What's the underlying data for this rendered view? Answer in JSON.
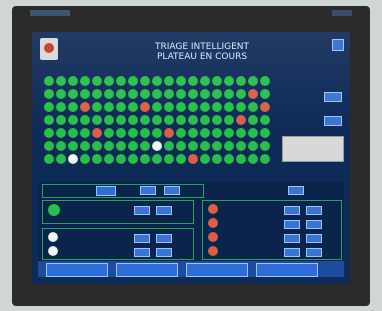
{
  "window": {
    "title_line1": "TRIAGE INTELLIGENT",
    "title_line2": "PLATEAU EN COURS"
  },
  "colors": {
    "screen_bg": "#0e2a57",
    "dot_green": "#27c04c",
    "dot_red": "#e25b4a",
    "dot_white": "#f4f4f4",
    "field_blue": "#3a74d1"
  },
  "grid": {
    "rows": 7,
    "cols": 19,
    "special": [
      {
        "r": 1,
        "c": 17,
        "state": "red"
      },
      {
        "r": 2,
        "c": 3,
        "state": "red"
      },
      {
        "r": 2,
        "c": 8,
        "state": "red"
      },
      {
        "r": 2,
        "c": 18,
        "state": "red"
      },
      {
        "r": 3,
        "c": 16,
        "state": "red"
      },
      {
        "r": 4,
        "c": 4,
        "state": "red"
      },
      {
        "r": 4,
        "c": 10,
        "state": "red"
      },
      {
        "r": 5,
        "c": 9,
        "state": "white"
      },
      {
        "r": 6,
        "c": 2,
        "state": "white"
      },
      {
        "r": 6,
        "c": 12,
        "state": "red"
      }
    ]
  },
  "icons": {
    "logo": "logo-icon",
    "corner": "square-button-icon",
    "status_dot_green": "green-dot-icon",
    "status_dot_red": "red-dot-icon"
  }
}
